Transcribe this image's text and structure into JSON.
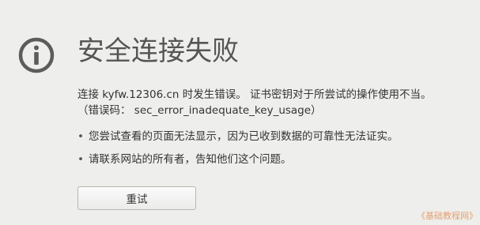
{
  "error_page": {
    "title": "安全连接失败",
    "message_line1": "连接 kyfw.12306.cn 时发生错误。 证书密钥对于所尝试的操作使用不当。",
    "message_line2": "（错误码： sec_error_inadequate_key_usage）",
    "reasons": [
      {
        "bullet": "•",
        "text": "您尝试查看的页面无法显示，因为已收到数据的可靠性无法证实。"
      },
      {
        "bullet": "•",
        "text": "请联系网站的所有者，告知他们这个问题。"
      }
    ],
    "retry_label": "重试",
    "icon": "info-circle-icon"
  },
  "watermark": "《基础教程网》",
  "colors": {
    "background": "#eeeeec",
    "title_text": "#555555",
    "icon_gray": "#5c5c5c",
    "body_text": "#333333",
    "watermark": "#e8a070"
  }
}
